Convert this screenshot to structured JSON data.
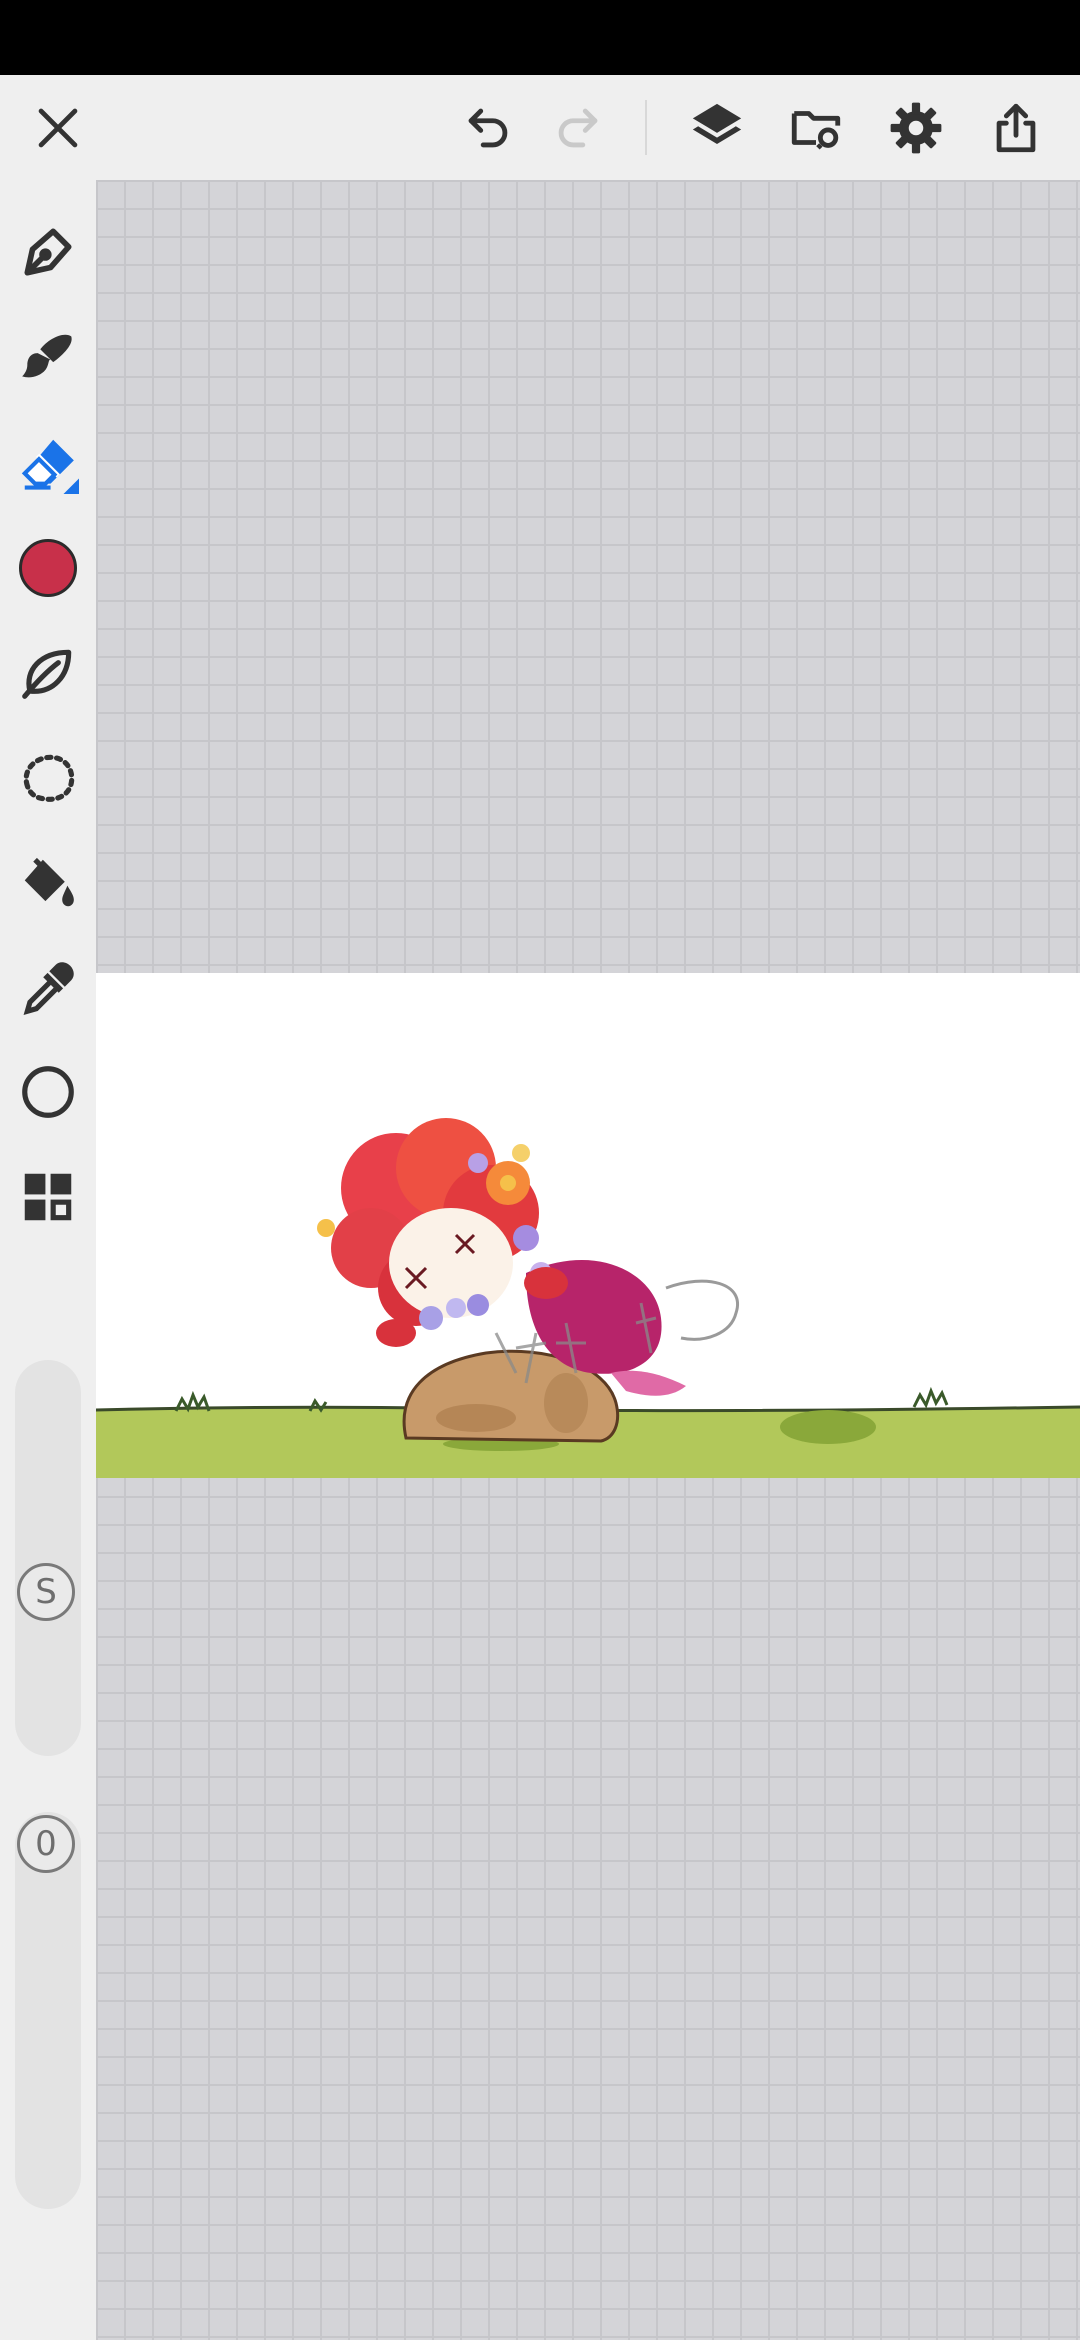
{
  "toolbar": {
    "close_icon": "close-icon",
    "undo_icon": "undo-icon",
    "redo_icon": "redo-icon",
    "layers_icon": "layers-icon",
    "import_icon": "folder-import-icon",
    "settings_icon": "gear-icon",
    "share_icon": "share-icon"
  },
  "tools": [
    {
      "name": "pen-tool",
      "icon": "pen-nib-icon"
    },
    {
      "name": "brush-tool",
      "icon": "brush-icon"
    },
    {
      "name": "eraser-tool",
      "icon": "eraser-icon",
      "selected": true
    },
    {
      "name": "color-picker",
      "icon": "color-swatch",
      "color": "#c8304a"
    },
    {
      "name": "smudge-tool",
      "icon": "leaf-icon"
    },
    {
      "name": "lasso-tool",
      "icon": "lasso-icon"
    },
    {
      "name": "fill-tool",
      "icon": "paint-bucket-icon"
    },
    {
      "name": "eyedropper-tool",
      "icon": "eyedropper-icon"
    },
    {
      "name": "shape-tool",
      "icon": "circle-icon"
    },
    {
      "name": "more-tools",
      "icon": "grid-icon"
    }
  ],
  "size_slider": {
    "label": "S"
  },
  "opacity_slider": {
    "label": "0"
  },
  "colors": {
    "accent": "#1a73e8",
    "swatch": "#c8304a",
    "grass": "#b2c85a",
    "grid_bg": "#d4d4d8"
  }
}
